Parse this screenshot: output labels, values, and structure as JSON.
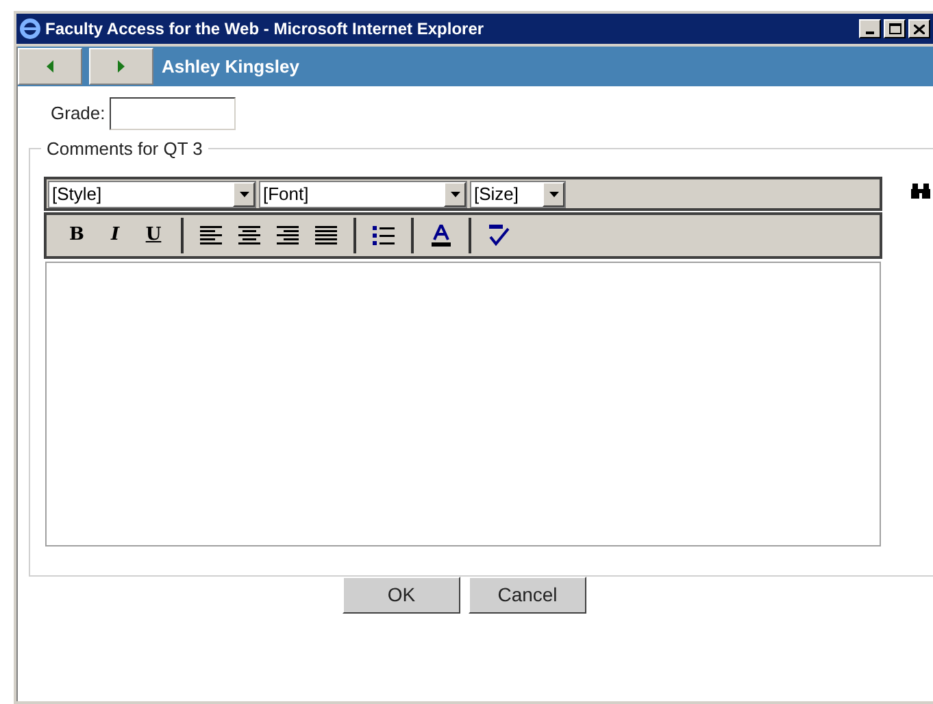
{
  "window": {
    "title": "Faculty Access for the Web - Microsoft Internet Explorer"
  },
  "header": {
    "student_name": "Ashley Kingsley"
  },
  "grade": {
    "label": "Grade:"
  },
  "comments": {
    "legend": "Comments for QT 3",
    "dropdowns": [
      "[Style]",
      "[Font]",
      "[Size]"
    ],
    "format_buttons": [
      "B",
      "I",
      "U"
    ]
  },
  "buttons": [
    "OK",
    "Cancel"
  ]
}
